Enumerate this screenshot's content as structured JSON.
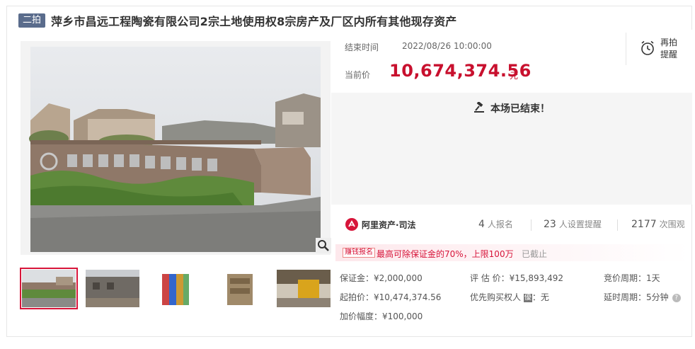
{
  "header": {
    "round_badge": "二拍",
    "title": "萍乡市昌远工程陶瓷有限公司2宗土地使用权8宗房产及厂区内所有其他现存资产"
  },
  "auction": {
    "end_time_label": "结束时间",
    "end_time_value": "2022/08/26 10:00:00",
    "current_price_label": "当前价",
    "current_price_value": "10,674,374.56",
    "current_price_unit": "元",
    "remind_label_1": "再拍",
    "remind_label_2": "提醒",
    "ended_text": "本场已结束！"
  },
  "platform": {
    "logo_text": "阿里资产·司法"
  },
  "stats": [
    {
      "num": "4",
      "unit": "人报名"
    },
    {
      "num": "23",
      "unit": "人设置提醒"
    },
    {
      "num": "2177",
      "unit": "次围观"
    }
  ],
  "promo": {
    "tag": "赚钱报名",
    "text": "最高可除保证金的70%，上限100万",
    "status": "已截止"
  },
  "details": {
    "deposit": "保证金：¥2,000,000",
    "start_price": "起拍价：¥10,474,374.56",
    "increment": "加价幅度：¥100,000",
    "appraisal": "评 估 价：¥15,893,492",
    "priority_label": "优先购买权人",
    "priority_badge": "優",
    "priority_value": "：无",
    "bid_period": "竞价周期：1天",
    "delay_period": "延时周期：5分钟",
    "help_glyph": "?"
  },
  "colors": {
    "accent": "#c8102e",
    "badge_bg": "#5a6c8c",
    "panel_bg": "#f5f5f5"
  }
}
